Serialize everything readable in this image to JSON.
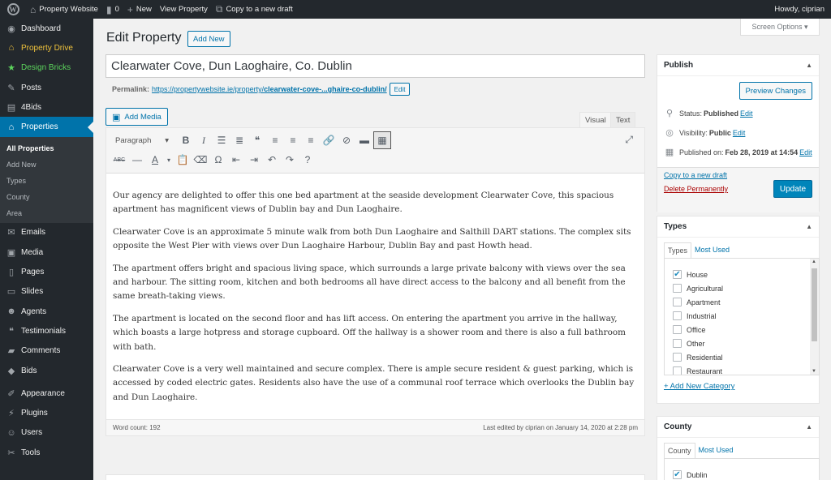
{
  "admin_bar": {
    "site_name": "Property Website",
    "comments_count": "0",
    "new_label": "New",
    "view_label": "View Property",
    "copy_label": "Copy to a new draft",
    "howdy": "Howdy, ciprian"
  },
  "sidebar": {
    "items_top": [
      {
        "label": "Dashboard",
        "icon": "dashboard-icon"
      },
      {
        "label": "Property Drive",
        "icon": "home-icon"
      },
      {
        "label": "Design Bricks",
        "icon": "star-icon"
      },
      {
        "label": "Posts",
        "icon": "pin-icon"
      },
      {
        "label": "4Bids",
        "icon": "bids-icon"
      },
      {
        "label": "Properties",
        "icon": "home-icon"
      }
    ],
    "submenu": [
      "All Properties",
      "Add New",
      "Types",
      "County",
      "Area"
    ],
    "items_bottom": [
      {
        "label": "Emails",
        "icon": "email-icon"
      },
      {
        "label": "Media",
        "icon": "media-icon"
      },
      {
        "label": "Pages",
        "icon": "pages-icon"
      },
      {
        "label": "Slides",
        "icon": "slides-icon"
      },
      {
        "label": "Agents",
        "icon": "agents-icon"
      },
      {
        "label": "Testimonials",
        "icon": "quote-icon"
      },
      {
        "label": "Comments",
        "icon": "comment-icon"
      },
      {
        "label": "Bids",
        "icon": "bids-icon"
      },
      {
        "label": "Appearance",
        "icon": "brush-icon"
      },
      {
        "label": "Plugins",
        "icon": "plugin-icon"
      },
      {
        "label": "Users",
        "icon": "user-icon"
      },
      {
        "label": "Tools",
        "icon": "wrench-icon"
      }
    ]
  },
  "header": {
    "screen_options": "Screen Options",
    "title": "Edit Property",
    "add_new": "Add New"
  },
  "post": {
    "title": "Clearwater Cove, Dun Laoghaire, Co. Dublin",
    "permalink_label": "Permalink:",
    "permalink_base": "https://propertywebsite.ie/property/",
    "permalink_slug": "clearwater-cove-...ghaire-co-dublin/",
    "permalink_edit": "Edit"
  },
  "editor": {
    "add_media": "Add Media",
    "tab_visual": "Visual",
    "tab_text": "Text",
    "paragraph_format": "Paragraph",
    "paragraphs": [
      "Our agency are delighted to offer this one bed apartment at the seaside development Clearwater Cove, this spacious apartment has magnificent views of Dublin bay and Dun Laoghaire.",
      "Clearwater Cove is an approximate 5 minute walk from both Dun Laoghaire and Salthill DART stations. The complex sits opposite the West Pier with views over Dun Laoghaire Harbour, Dublin Bay and past Howth head.",
      "The apartment offers bright and spacious living space, which surrounds a large private balcony with views over the sea and harbour. The sitting room, kitchen and both bedrooms all have direct access to the balcony and all benefit from the same breath-taking views.",
      "The apartment is located on the second floor and has lift access. On entering the apartment you arrive in the hallway, which boasts a large hotpress and storage cupboard. Off the hallway is a shower room and there is also a full bathroom with bath.",
      "Clearwater Cove is a very well maintained and secure complex. There is ample secure resident & guest parking, which is accessed by coded electric gates. Residents also have the use of a communal roof terrace which overlooks the Dublin bay and Dun Laoghaire."
    ],
    "word_count": "Word count: 192",
    "last_edited": "Last edited by ciprian on January 14, 2020 at 2:28 pm"
  },
  "publish": {
    "title": "Publish",
    "preview": "Preview Changes",
    "status_label": "Status:",
    "status_value": "Published",
    "visibility_label": "Visibility:",
    "visibility_value": "Public",
    "published_label": "Published on:",
    "published_value": "Feb 28, 2019 at 14:54",
    "edit": "Edit",
    "copy_draft": "Copy to a new draft",
    "delete": "Delete Permanently",
    "update": "Update"
  },
  "types": {
    "title": "Types",
    "tab_all": "Types",
    "tab_used": "Most Used",
    "items": [
      {
        "label": "House",
        "checked": true
      },
      {
        "label": "Agricultural",
        "checked": false
      },
      {
        "label": "Apartment",
        "checked": false
      },
      {
        "label": "Industrial",
        "checked": false
      },
      {
        "label": "Office",
        "checked": false
      },
      {
        "label": "Other",
        "checked": false
      },
      {
        "label": "Residential",
        "checked": false
      },
      {
        "label": "Restaurant",
        "checked": false
      }
    ],
    "add_new": "+ Add New Category"
  },
  "county": {
    "title": "County",
    "tab_all": "County",
    "tab_used": "Most Used",
    "items": [
      {
        "label": "Dublin",
        "checked": true
      }
    ]
  },
  "colors": {
    "accent": "#0073aa",
    "sidebar": "#23282d",
    "update_button": "#0085ba"
  }
}
